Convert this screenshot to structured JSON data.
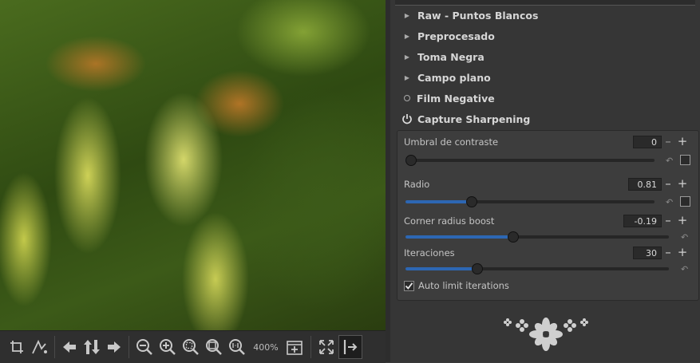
{
  "viewer": {
    "zoom_label": "400%"
  },
  "panel": {
    "sections": [
      {
        "label": "Raw - Puntos Blancos",
        "state": "collapsed"
      },
      {
        "label": "Preprocesado",
        "state": "collapsed"
      },
      {
        "label": "Toma Negra",
        "state": "collapsed"
      },
      {
        "label": "Campo plano",
        "state": "collapsed"
      },
      {
        "label": "Film Negative",
        "state": "disabled"
      },
      {
        "label": "Capture Sharpening",
        "state": "enabled"
      }
    ],
    "capture_sharpening": {
      "params": [
        {
          "label": "Umbral de contraste",
          "value": "0",
          "min": 0,
          "max": 200,
          "num": 0
        },
        {
          "label": "Radio",
          "value": "0.81",
          "min": 0.4,
          "max": 2.0,
          "num": 0.81
        },
        {
          "label": "Corner radius boost",
          "value": "-0.19",
          "min": -1.0,
          "max": 1.0,
          "num": -0.19
        },
        {
          "label": "Iteraciones",
          "value": "30",
          "min": 5,
          "max": 100,
          "num": 30
        }
      ],
      "auto_limit": {
        "label": "Auto limit iterations",
        "checked": true
      }
    }
  },
  "colors": {
    "accent": "#2d67b3",
    "panel_bg": "#363636",
    "toolbar_bg": "#2f2f2f"
  },
  "icons": [
    "crop-icon",
    "straighten-icon",
    "arrow-left-icon",
    "arrows-updown-icon",
    "arrow-right-icon",
    "zoom-out-icon",
    "zoom-in-icon",
    "zoom-fit-icon",
    "zoom-fill-icon",
    "zoom-100-icon",
    "new-detail-window-icon",
    "fullscreen-icon",
    "hide-panel-icon",
    "power-icon",
    "reset-icon",
    "flower-logo-icon"
  ]
}
